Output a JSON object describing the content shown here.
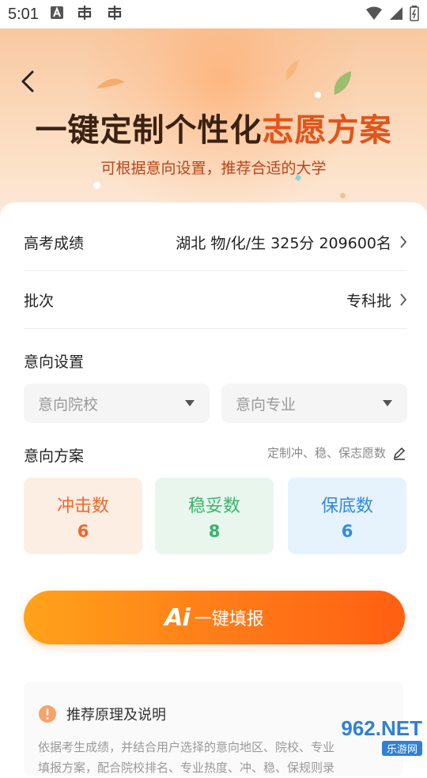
{
  "status_bar": {
    "time": "5:01"
  },
  "hero": {
    "title_part1": "一键定制个性化",
    "title_part2": "志愿方案",
    "subtitle": "可根据意向设置，推荐合适的大学"
  },
  "score_row": {
    "label": "高考成绩",
    "value": "湖北 物/化/生 325分 209600名"
  },
  "batch_row": {
    "label": "批次",
    "value": "专科批"
  },
  "intent": {
    "label": "意向设置",
    "school_placeholder": "意向院校",
    "major_placeholder": "意向专业"
  },
  "plan": {
    "label": "意向方案",
    "hint": "定制冲、稳、保志愿数",
    "boxes": [
      {
        "title": "冲击数",
        "count": "6"
      },
      {
        "title": "稳妥数",
        "count": "8"
      },
      {
        "title": "保底数",
        "count": "6"
      }
    ]
  },
  "ai_button": {
    "ai_text": "Ai",
    "label": "一键填报"
  },
  "notice": {
    "title": "推荐原理及说明",
    "line1": "依据考生成绩，并结合用户选择的意向地区、院校、专业",
    "line2": "填报方案，配合院校排名、专业热度、冲、稳、保规则录"
  },
  "watermark": {
    "brand": "962.NET",
    "site": "乐游网"
  },
  "colors": {
    "accent": "#ff7a18",
    "rush_bg": "#fdeee4",
    "rush_text": "#f0672a",
    "stable_bg": "#e8f6ee",
    "stable_text": "#39b36a",
    "safe_bg": "#e6f2fc",
    "safe_text": "#2f8ae0"
  }
}
